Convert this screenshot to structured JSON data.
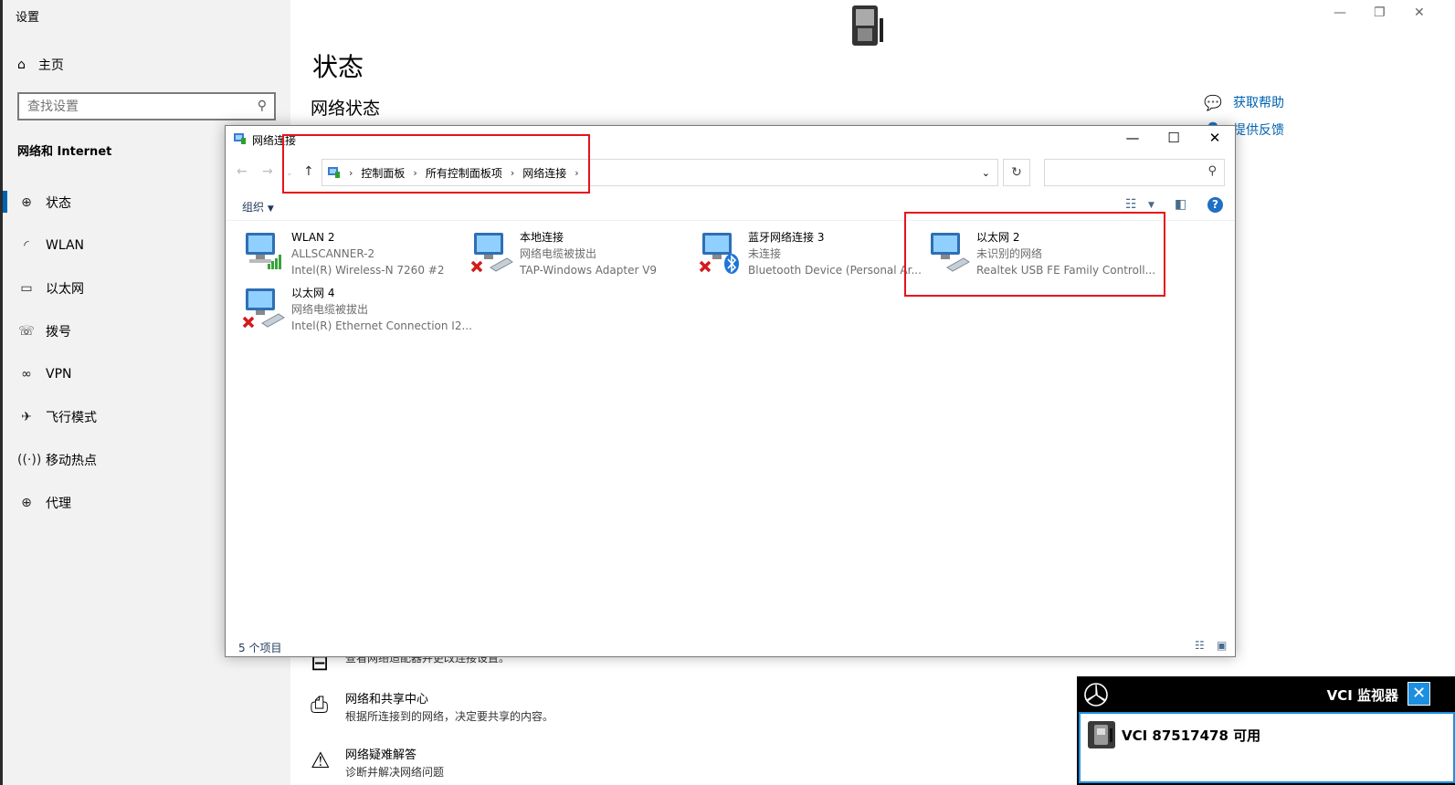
{
  "settings": {
    "window_title": "设置",
    "home_label": "主页",
    "search_placeholder": "查找设置",
    "section_title": "网络和 Internet",
    "nav": [
      {
        "label": "状态",
        "icon": "status-icon"
      },
      {
        "label": "WLAN",
        "icon": "wlan-icon"
      },
      {
        "label": "以太网",
        "icon": "ethernet-icon"
      },
      {
        "label": "拨号",
        "icon": "dialup-icon"
      },
      {
        "label": "VPN",
        "icon": "vpn-icon"
      },
      {
        "label": "飞行模式",
        "icon": "airplane-icon"
      },
      {
        "label": "移动热点",
        "icon": "hotspot-icon"
      },
      {
        "label": "代理",
        "icon": "globe-icon"
      }
    ],
    "main_title": "状态",
    "main_subtitle": "网络状态",
    "help_link": "获取帮助",
    "feedback_link": "提供反馈",
    "lower_items": [
      {
        "title": "",
        "desc": "查看网络适配器并更改连接设置。",
        "icon": "adapter-icon"
      },
      {
        "title": "网络和共享中心",
        "desc": "根据所连接到的网络，决定要共享的内容。",
        "icon": "sharing-center-icon"
      },
      {
        "title": "网络疑难解答",
        "desc": "诊断并解决网络问题",
        "icon": "warning-icon"
      }
    ]
  },
  "explorer": {
    "title": "网络连接",
    "breadcrumb": [
      "控制面板",
      "所有控制面板项",
      "网络连接"
    ],
    "organize": "组织",
    "status_count": "5 个项目",
    "connections": [
      {
        "name": "WLAN 2",
        "status": "ALLSCANNER-2",
        "device": "Intel(R) Wireless-N 7260 #2",
        "badge": "signal"
      },
      {
        "name": "本地连接",
        "status": "网络电缆被拔出",
        "device": "TAP-Windows Adapter V9",
        "badge": "x"
      },
      {
        "name": "蓝牙网络连接 3",
        "status": "未连接",
        "device": "Bluetooth Device (Personal Ar...",
        "badge": "bluetooth"
      },
      {
        "name": "以太网 2",
        "status": "未识别的网络",
        "device": "Realtek USB FE Family Controll...",
        "badge": "none"
      },
      {
        "name": "以太网 4",
        "status": "网络电缆被拔出",
        "device": "Intel(R) Ethernet Connection I2...",
        "badge": "x"
      }
    ]
  },
  "vci": {
    "title": "VCI 监视器",
    "message": "VCI 87517478 可用"
  },
  "colors": {
    "accent": "#0063b1",
    "highlight_red": "#e8121b",
    "vci_blue": "#1d8fe0"
  }
}
